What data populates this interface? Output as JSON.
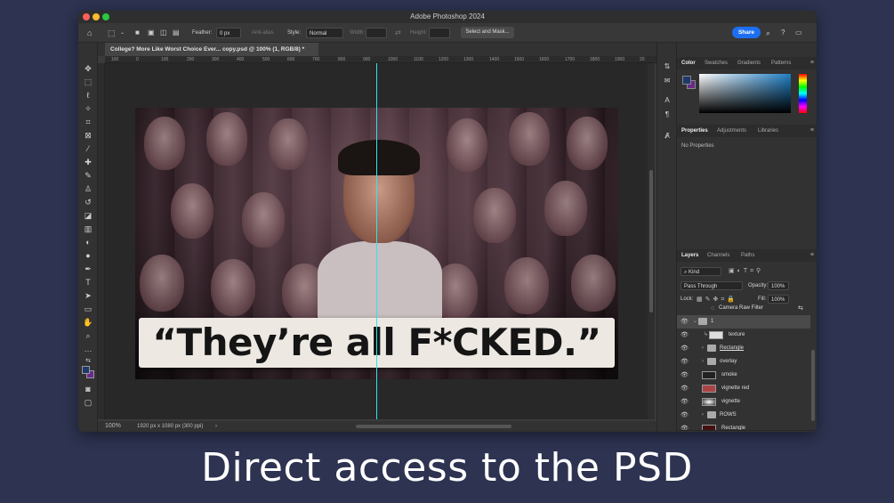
{
  "app": {
    "title": "Adobe Photoshop 2024"
  },
  "options": {
    "feather_label": "Feather:",
    "feather_value": "0 px",
    "antialias": "Anti-alias",
    "style_label": "Style:",
    "style_value": "Normal",
    "width_label": "Width:",
    "height_label": "Height:",
    "select_mask": "Select and Mask...",
    "share": "Share"
  },
  "document": {
    "tab": "College? More Like Worst Choice Ever... copy.psd @ 100% (1, RGB/8) *",
    "zoom": "100%",
    "info": "1920 px x 1080 px (300 ppi)",
    "banner_text": "“They’re all F*CKED.”"
  },
  "ruler_ticks": [
    "100",
    "0",
    "100",
    "200",
    "300",
    "400",
    "500",
    "600",
    "700",
    "800",
    "900",
    "1000",
    "1100",
    "1200",
    "1300",
    "1400",
    "1500",
    "1600",
    "1700",
    "1800",
    "1900",
    "20"
  ],
  "top_panel": {
    "tabs": [
      "Color",
      "Swatches",
      "Gradients",
      "Patterns"
    ]
  },
  "props_panel": {
    "tabs": [
      "Properties",
      "Adjustments",
      "Libraries"
    ],
    "empty": "No Properties"
  },
  "layers_panel": {
    "tabs": [
      "Layers",
      "Channels",
      "Paths"
    ],
    "kind": "Kind",
    "blend": "Pass Through",
    "opacity_label": "Opacity:",
    "opacity": "100%",
    "lock_label": "Lock:",
    "fill_label": "Fill:",
    "fill": "100%",
    "filter": "Camera Raw Filter",
    "layers": [
      "1",
      "texture",
      "Rectangle",
      "overlay",
      "smoke",
      "vignette red",
      "vignette",
      "ROWS",
      "Rectangle"
    ]
  },
  "caption": "Direct access to the PSD",
  "colors": {
    "accent": "#1d6ff2",
    "guide": "#2ee6e6",
    "background": "#2d3350"
  }
}
